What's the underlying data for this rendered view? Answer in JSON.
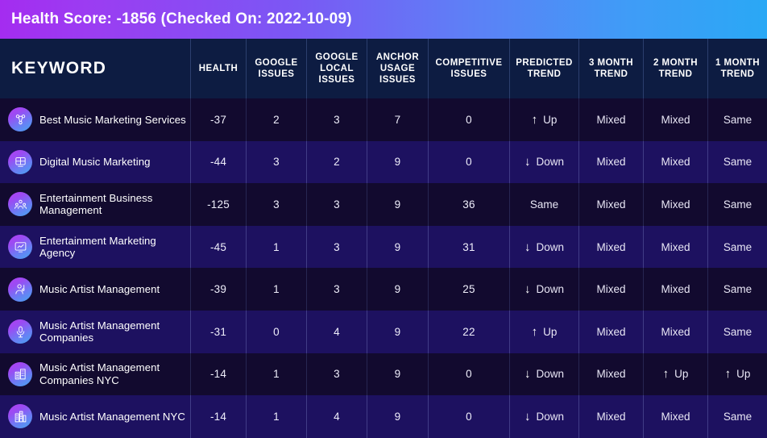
{
  "banner": {
    "title": "Health Score: -1856 (Checked On: 2022-10-09)",
    "gradient_start": "#a42cf0",
    "gradient_end": "#2aa8f5",
    "health_score": -1856,
    "checked_on": "2022-10-09"
  },
  "table": {
    "columns": [
      {
        "key": "keyword",
        "label": "KEYWORD"
      },
      {
        "key": "health",
        "label": "HEALTH"
      },
      {
        "key": "google_issues",
        "label": "GOOGLE ISSUES"
      },
      {
        "key": "google_local_issues",
        "label": "GOOGLE LOCAL ISSUES"
      },
      {
        "key": "anchor_usage_issues",
        "label": "ANCHOR USAGE ISSUES"
      },
      {
        "key": "competitive_issues",
        "label": "COMPETITIVE ISSUES"
      },
      {
        "key": "predicted_trend",
        "label": "PREDICTED TREND"
      },
      {
        "key": "month_3_trend",
        "label": "3 MONTH TREND"
      },
      {
        "key": "month_2_trend",
        "label": "2 MONTH TREND"
      },
      {
        "key": "month_1_trend",
        "label": "1 MONTH TREND"
      }
    ],
    "header_bg": "#0d1c42",
    "row_even_bg": "#120a2f",
    "row_odd_bg": "#1d1160",
    "rows": [
      {
        "icon": "people-network-icon",
        "keyword": "Best Music Marketing Services",
        "health": "-37",
        "google_issues": "2",
        "google_local_issues": "3",
        "anchor_usage_issues": "7",
        "competitive_issues": "0",
        "predicted_trend": "Up",
        "predicted_trend_arrow": "up",
        "month_3_trend": "Mixed",
        "month_3_trend_arrow": "none",
        "month_2_trend": "Mixed",
        "month_2_trend_arrow": "none",
        "month_1_trend": "Same",
        "month_1_trend_arrow": "none"
      },
      {
        "icon": "megaphone-board-icon",
        "keyword": "Digital Music Marketing",
        "health": "-44",
        "google_issues": "3",
        "google_local_issues": "2",
        "anchor_usage_issues": "9",
        "competitive_issues": "0",
        "predicted_trend": "Down",
        "predicted_trend_arrow": "down",
        "month_3_trend": "Mixed",
        "month_3_trend_arrow": "none",
        "month_2_trend": "Mixed",
        "month_2_trend_arrow": "none",
        "month_1_trend": "Same",
        "month_1_trend_arrow": "none"
      },
      {
        "icon": "team-group-icon",
        "keyword": "Entertainment Business Management",
        "health": "-125",
        "google_issues": "3",
        "google_local_issues": "3",
        "anchor_usage_issues": "9",
        "competitive_issues": "36",
        "predicted_trend": "Same",
        "predicted_trend_arrow": "none",
        "month_3_trend": "Mixed",
        "month_3_trend_arrow": "none",
        "month_2_trend": "Mixed",
        "month_2_trend_arrow": "none",
        "month_1_trend": "Same",
        "month_1_trend_arrow": "none"
      },
      {
        "icon": "screen-chart-icon",
        "keyword": "Entertainment Marketing Agency",
        "health": "-45",
        "google_issues": "1",
        "google_local_issues": "3",
        "anchor_usage_issues": "9",
        "competitive_issues": "31",
        "predicted_trend": "Down",
        "predicted_trend_arrow": "down",
        "month_3_trend": "Mixed",
        "month_3_trend_arrow": "none",
        "month_2_trend": "Mixed",
        "month_2_trend_arrow": "none",
        "month_1_trend": "Same",
        "month_1_trend_arrow": "none"
      },
      {
        "icon": "person-music-icon",
        "keyword": "Music Artist Management",
        "health": "-39",
        "google_issues": "1",
        "google_local_issues": "3",
        "anchor_usage_issues": "9",
        "competitive_issues": "25",
        "predicted_trend": "Down",
        "predicted_trend_arrow": "down",
        "month_3_trend": "Mixed",
        "month_3_trend_arrow": "none",
        "month_2_trend": "Mixed",
        "month_2_trend_arrow": "none",
        "month_1_trend": "Same",
        "month_1_trend_arrow": "none"
      },
      {
        "icon": "microphone-icon",
        "keyword": "Music Artist Management Companies",
        "health": "-31",
        "google_issues": "0",
        "google_local_issues": "4",
        "anchor_usage_issues": "9",
        "competitive_issues": "22",
        "predicted_trend": "Up",
        "predicted_trend_arrow": "up",
        "month_3_trend": "Mixed",
        "month_3_trend_arrow": "none",
        "month_2_trend": "Mixed",
        "month_2_trend_arrow": "none",
        "month_1_trend": "Same",
        "month_1_trend_arrow": "none"
      },
      {
        "icon": "city-buildings-icon",
        "keyword": "Music Artist Management Companies NYC",
        "health": "-14",
        "google_issues": "1",
        "google_local_issues": "3",
        "anchor_usage_issues": "9",
        "competitive_issues": "0",
        "predicted_trend": "Down",
        "predicted_trend_arrow": "down",
        "month_3_trend": "Mixed",
        "month_3_trend_arrow": "none",
        "month_2_trend": "Up",
        "month_2_trend_arrow": "up",
        "month_1_trend": "Up",
        "month_1_trend_arrow": "up"
      },
      {
        "icon": "skyline-icon",
        "keyword": "Music Artist Management NYC",
        "health": "-14",
        "google_issues": "1",
        "google_local_issues": "4",
        "anchor_usage_issues": "9",
        "competitive_issues": "0",
        "predicted_trend": "Down",
        "predicted_trend_arrow": "down",
        "month_3_trend": "Mixed",
        "month_3_trend_arrow": "none",
        "month_2_trend": "Mixed",
        "month_2_trend_arrow": "none",
        "month_1_trend": "Same",
        "month_1_trend_arrow": "none"
      }
    ]
  },
  "glyphs": {
    "arrow_up": "↑",
    "arrow_down": "↓"
  }
}
